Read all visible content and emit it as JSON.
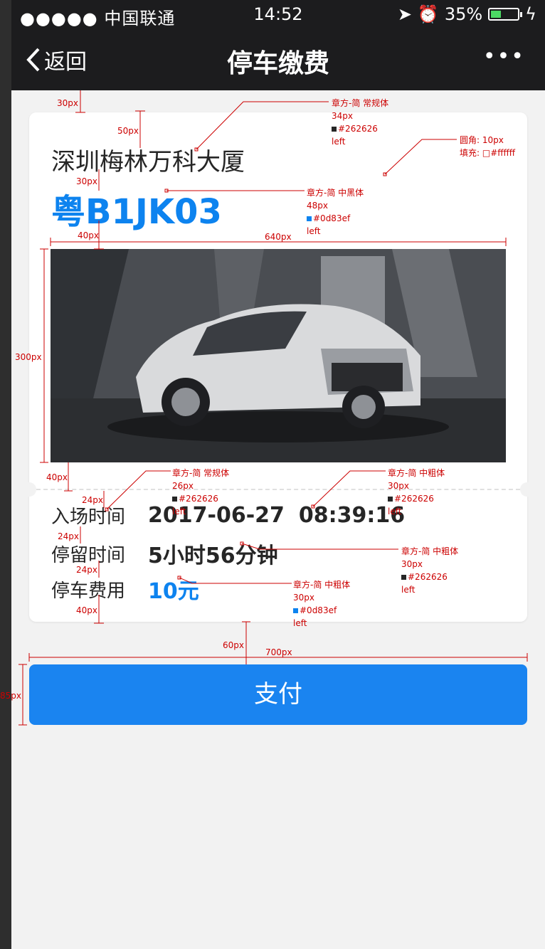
{
  "status_bar": {
    "carrier": "●●●●● 中国联通",
    "time": "14:52",
    "battery": "35%"
  },
  "nav": {
    "back_label": "返回",
    "title": "停车缴费",
    "more": "•••"
  },
  "parking": {
    "building": "深圳梅林万科大厦",
    "plate": "粤B1JK03",
    "details": [
      {
        "label": "入场时间",
        "value": "2017-06-27",
        "value2": "08:39:16"
      },
      {
        "label": "停留时间",
        "value": "5小时56分钟"
      },
      {
        "label": "停车费用",
        "value": "10元"
      }
    ]
  },
  "pay_button": "支付",
  "colors": {
    "accent": "#0d83ef",
    "text": "#262626",
    "card": "#ffffff"
  },
  "annotations": {
    "dim_30": "30px",
    "dim_50": "50px",
    "dim_30b": "30px",
    "dim_40": "40px",
    "dim_640": "640px",
    "dim_300": "300px",
    "dim_40b": "40px",
    "dim_24a": "24px",
    "dim_24b": "24px",
    "dim_24c": "24px",
    "dim_40c": "40px",
    "dim_60": "60px",
    "dim_700": "700px",
    "dim_85": "85px",
    "a1": [
      "章方-简 常规体",
      "34px",
      "#262626",
      "left"
    ],
    "a2": [
      "圆角: 10px",
      "填充: □#ffffff"
    ],
    "a3": [
      "章方-简 中黑体",
      "48px",
      "#0d83ef",
      "left"
    ],
    "a4": [
      "章方-简 常规体",
      "26px",
      "#262626",
      "left"
    ],
    "a5": [
      "章方-简 中粗体",
      "30px",
      "#262626",
      "left"
    ],
    "a6": [
      "章方-简 中粗体",
      "30px",
      "#262626",
      "left"
    ],
    "a7": [
      "章方-简 中粗体",
      "30px",
      "#0d83ef",
      "left"
    ]
  }
}
